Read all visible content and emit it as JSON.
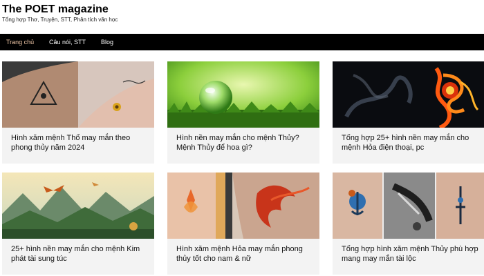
{
  "site": {
    "title": "The POET magazine",
    "tagline": "Tổng hợp Thơ, Truyện, STT, Phân tích văn học"
  },
  "nav": {
    "items": [
      {
        "label": "Trang chủ",
        "active": true
      },
      {
        "label": "Câu nói, STT",
        "active": false
      },
      {
        "label": "Blog",
        "active": false
      }
    ]
  },
  "posts": [
    {
      "title": "Hình xăm mệnh Thổ may mắn theo phong thủy năm 2024",
      "image": "tattoo-arm-pyramid-and-sunflower"
    },
    {
      "title": "Hình nền may mắn cho mệnh Thủy? Mệnh Thủy để hoa gì?",
      "image": "water-drop-on-grass"
    },
    {
      "title": "Tổng hợp 25+ hình nền may mắn cho mệnh Hỏa điện thoại, pc",
      "image": "fire-flower-with-smoke"
    },
    {
      "title": "25+ hình nền may mắn cho mệnh Kim phát tài sung túc",
      "image": "mountain-landscape-with-birds"
    },
    {
      "title": "Hình xăm mệnh Hỏa may mắn phong thủy tốt cho nam & nữ",
      "image": "phoenix-tattoo-on-arm"
    },
    {
      "title": "Tổng hợp hình xăm mệnh Thủy phù hợp mang may mắn tài lộc",
      "image": "anchor-and-fish-tattoos"
    }
  ],
  "colors": {
    "navbar_bg": "#000000",
    "nav_active": "#f2c9a8",
    "card_bg": "#f3f3f3"
  }
}
